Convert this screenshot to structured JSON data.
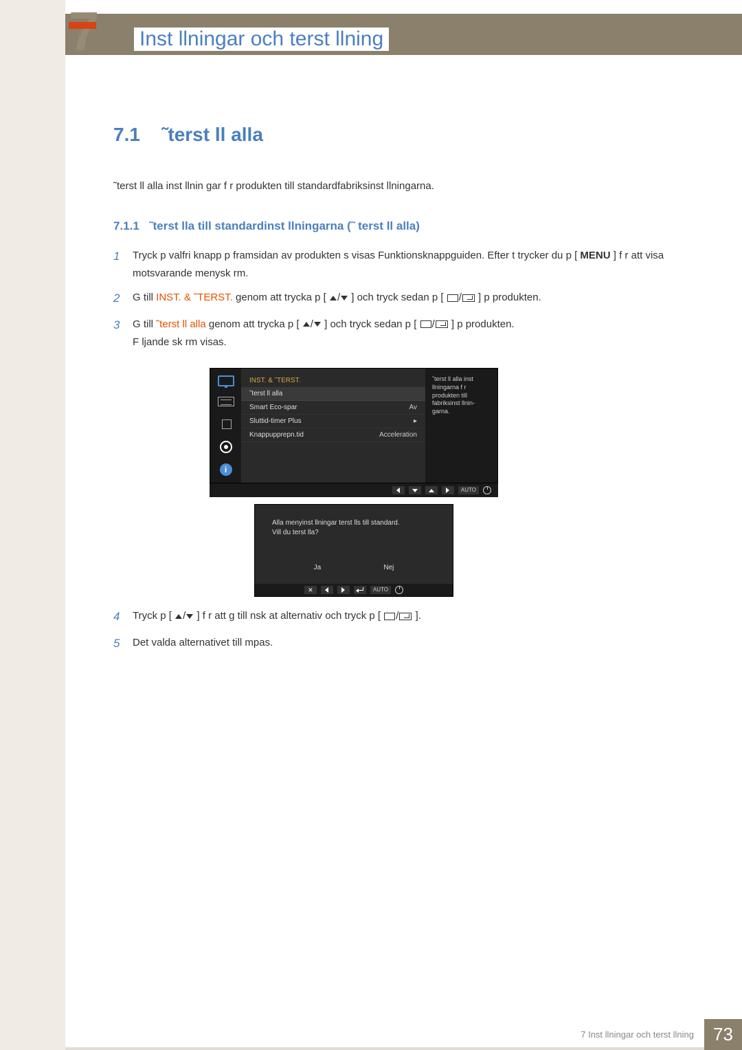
{
  "chapter": {
    "number": "7",
    "title": "Inst llningar och  terst llning"
  },
  "section": {
    "number": "7.1",
    "title": "˜terst ll alla"
  },
  "intro": "˜terst ll alla inst llnin gar f r produkten till standardfabriksinst llningarna.",
  "subsection": {
    "number": "7.1.1",
    "title": "˜terst lla till standardinst     llningarna (˜   terst ll alla)"
  },
  "steps": {
    "s1": {
      "num": "1",
      "text_a": "Tryck p  valfri knapp p  framsidan av produkten s  visas Funktionsknappguiden. Efter t trycker du p  [",
      "menu": "MENU",
      "text_b": "] f r att visa  motsvarande menysk rm."
    },
    "s2": {
      "num": "2",
      "text_a": "G  till ",
      "orange": "INST. & ˜TERST.",
      "text_b": " genom att trycka p  [",
      "text_c": "] och tryck sedan p  [",
      "text_d": "] p  produkten."
    },
    "s3": {
      "num": "3",
      "text_a": "G  till ",
      "orange": "˜terst ll alla",
      "text_b": "   genom att trycka p  [",
      "text_c": "] och tryck sedan p  [",
      "text_d": "] p  produkten.",
      "follow": "F ljande sk rm visas."
    },
    "s4": {
      "num": "4",
      "text_a": "Tryck p  [",
      "text_b": "] f r att g  till  nsk   at alternativ och tryck p  [",
      "text_c": "]."
    },
    "s5": {
      "num": "5",
      "text": "Det valda alternativet till mpas."
    }
  },
  "osd1": {
    "header": "INST. & ˜TERST.",
    "rows": [
      {
        "label": "˜terst ll alla",
        "value": ""
      },
      {
        "label": "Smart Eco-spar",
        "value": "Av"
      },
      {
        "label": "Sluttid-timer Plus",
        "value": "▸"
      },
      {
        "label": "Knappupprepn.tid",
        "value": "Acceleration"
      }
    ],
    "side": "˜terst ll alla inst llningarna f r produkten till fabriksinst llnin-garna.",
    "info_icon": "i",
    "auto": "AUTO"
  },
  "osd2": {
    "line1": "Alla menyinst llningar  terst lls till standard.",
    "line2": "Vill du  terst lla?",
    "yes": "Ja",
    "no": "Nej",
    "auto": "AUTO"
  },
  "footer": {
    "text": "7 Inst llningar och  terst llning",
    "page": "73"
  }
}
